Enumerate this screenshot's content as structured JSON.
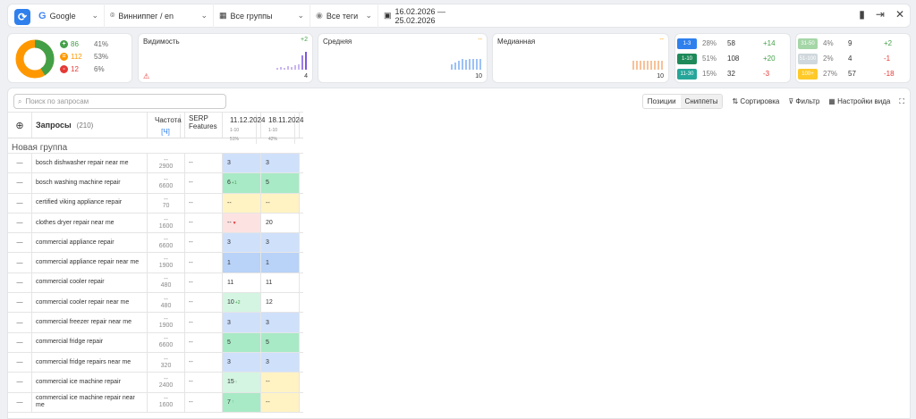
{
  "topbar": {
    "engine": "Google",
    "region": "Винниппег / en",
    "groups": "Все группы",
    "tags": "Все теги",
    "dates": "16.02.2026 — 25.02.2026"
  },
  "summary": {
    "up": {
      "count": "86",
      "pct": "41%"
    },
    "same": {
      "count": "112",
      "pct": "53%"
    },
    "down": {
      "count": "12",
      "pct": "6%"
    }
  },
  "metrics": [
    {
      "title": "Видимость",
      "delta": "+2",
      "value": "4"
    },
    {
      "title": "Средняя",
      "delta": "--",
      "value": "10"
    },
    {
      "title": "Медианная",
      "delta": "--",
      "value": "10"
    }
  ],
  "ranges_left": [
    {
      "label": "1-3",
      "pct": "28%",
      "count": "58",
      "delta": "+14",
      "color": "#2f80ed"
    },
    {
      "label": "1-10",
      "pct": "51%",
      "count": "108",
      "delta": "+20",
      "color": "#1e8a5a"
    },
    {
      "label": "11-30",
      "pct": "15%",
      "count": "32",
      "delta": "-3",
      "color": "#26a69a"
    }
  ],
  "ranges_right": [
    {
      "label": "31-50",
      "pct": "4%",
      "count": "9",
      "delta": "+2",
      "color": "#a5d6a7"
    },
    {
      "label": "51-100",
      "pct": "2%",
      "count": "4",
      "delta": "-1",
      "color": "#cfd8dc"
    },
    {
      "label": "100+",
      "pct": "27%",
      "count": "57",
      "delta": "-18",
      "color": "#ffca28"
    }
  ],
  "search": {
    "placeholder": "Поиск по запросам"
  },
  "toolbar": {
    "positions": "Позиции",
    "snippets": "Сниппеты",
    "sort": "Сортировка",
    "filter": "Фильтр",
    "view": "Настройки вида"
  },
  "table": {
    "queries_label": "Запросы",
    "queries_count": "(210)",
    "freq_label": "Частота",
    "freq_unit": "[Ч]",
    "serp_label": "SERP Features",
    "date1": "11.12.2024",
    "date1_sub": "1-10",
    "date1_pct": "51%",
    "date2": "18.11.2024",
    "date2_sub": "1-10",
    "date2_pct": "42%",
    "group": "Новая группа",
    "rows": [
      {
        "q": "bosch dishwasher repair near me",
        "f": "2900",
        "p1": "3",
        "d1": "",
        "p2": "3",
        "bg1": "#cfe0fb",
        "bg2": "#cfe0fb"
      },
      {
        "q": "bosch washing machine repair",
        "f": "6600",
        "p1": "6",
        "d1": "+1",
        "p2": "5",
        "bg1": "#a8eac6",
        "bg2": "#a8eac6"
      },
      {
        "q": "certified viking appliance repair",
        "f": "70",
        "p1": "--",
        "d1": "",
        "p2": "--",
        "bg1": "#fff3c4",
        "bg2": "#fff3c4"
      },
      {
        "q": "clothes dryer repair near me",
        "f": "1600",
        "p1": "--",
        "d1": "▼",
        "p2": "20",
        "bg1": "#fde2e2",
        "bg2": "#ffffff"
      },
      {
        "q": "commercial appliance repair",
        "f": "6600",
        "p1": "3",
        "d1": "",
        "p2": "3",
        "bg1": "#cfe0fb",
        "bg2": "#cfe0fb"
      },
      {
        "q": "commercial appliance repair near me",
        "f": "1900",
        "p1": "1",
        "d1": "",
        "p2": "1",
        "bg1": "#b9d2f7",
        "bg2": "#b9d2f7"
      },
      {
        "q": "commercial cooler repair",
        "f": "480",
        "p1": "11",
        "d1": "",
        "p2": "11",
        "bg1": "#ffffff",
        "bg2": "#ffffff"
      },
      {
        "q": "commercial cooler repair near me",
        "f": "480",
        "p1": "10",
        "d1": "+2",
        "p2": "12",
        "bg1": "#d4f5e2",
        "bg2": "#ffffff"
      },
      {
        "q": "commercial freezer repair near me",
        "f": "1900",
        "p1": "3",
        "d1": "",
        "p2": "3",
        "bg1": "#cfe0fb",
        "bg2": "#cfe0fb"
      },
      {
        "q": "commercial fridge repair",
        "f": "6600",
        "p1": "5",
        "d1": "",
        "p2": "5",
        "bg1": "#a8eac6",
        "bg2": "#a8eac6"
      },
      {
        "q": "commercial fridge repairs near me",
        "f": "320",
        "p1": "3",
        "d1": "",
        "p2": "3",
        "bg1": "#cfe0fb",
        "bg2": "#cfe0fb"
      },
      {
        "q": "commercial ice machine repair",
        "f": "2400",
        "p1": "15",
        "d1": "↑",
        "p2": "--",
        "bg1": "#d4f5e2",
        "bg2": "#fff3c4"
      },
      {
        "q": "commercial ice machine repair near me",
        "f": "1600",
        "p1": "7",
        "d1": "↑",
        "p2": "--",
        "bg1": "#a8eac6",
        "bg2": "#fff3c4"
      }
    ]
  }
}
